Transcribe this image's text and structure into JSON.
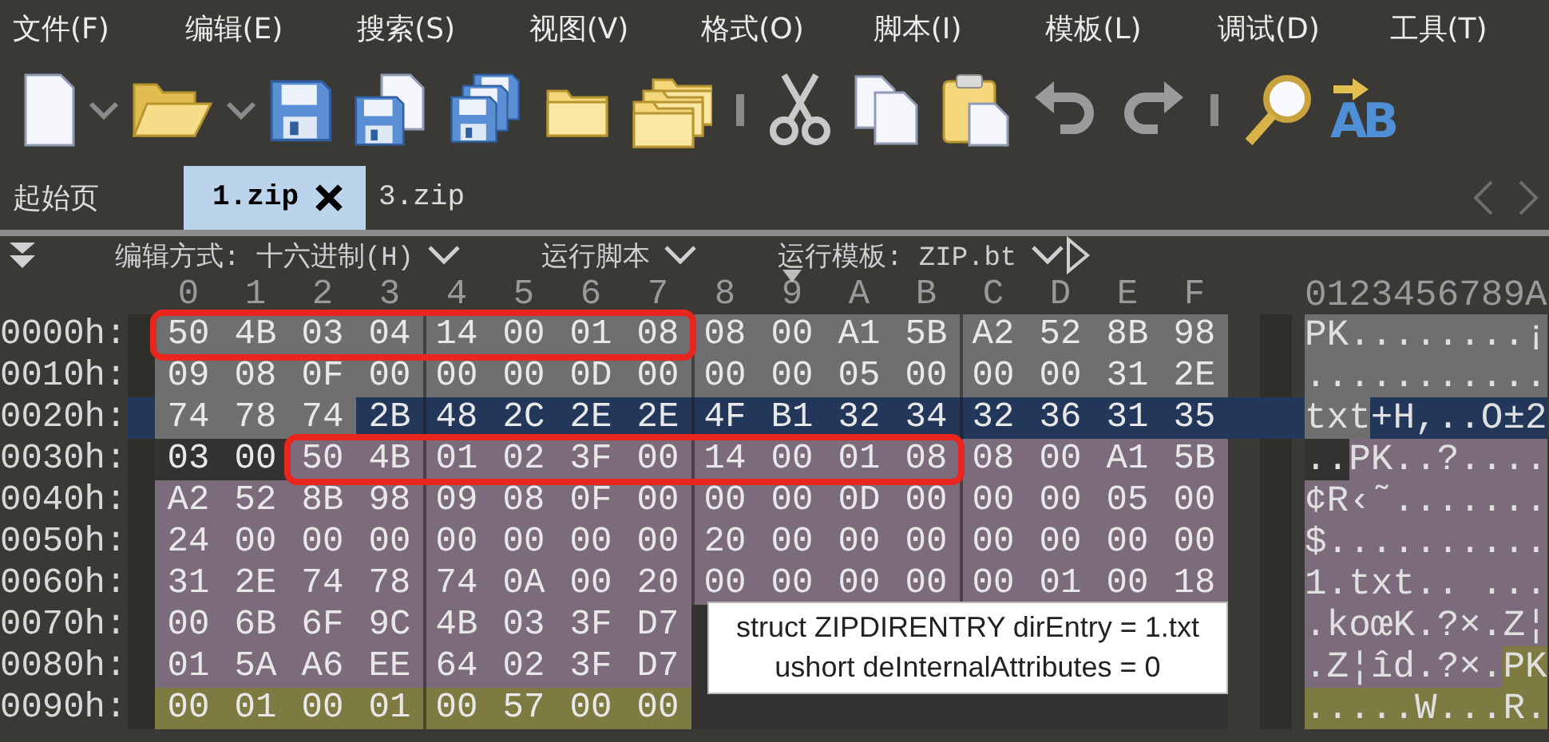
{
  "menu": [
    "文件(F)",
    "编辑(E)",
    "搜索(S)",
    "视图(V)",
    "格式(O)",
    "脚本(I)",
    "模板(L)",
    "调试(D)",
    "工具(T)"
  ],
  "toolbar": [
    {
      "kind": "new"
    },
    {
      "kind": "dropdown"
    },
    {
      "kind": "open"
    },
    {
      "kind": "dropdown"
    },
    {
      "kind": "save"
    },
    {
      "kind": "save-as"
    },
    {
      "kind": "save-all"
    },
    {
      "kind": "folder"
    },
    {
      "kind": "folders"
    },
    {
      "kind": "separator"
    },
    {
      "kind": "cut"
    },
    {
      "kind": "copy"
    },
    {
      "kind": "paste"
    },
    {
      "kind": "undo"
    },
    {
      "kind": "redo"
    },
    {
      "kind": "separator"
    },
    {
      "kind": "find"
    },
    {
      "kind": "replace",
      "label": "AB"
    }
  ],
  "tabs": [
    {
      "label": "起始页",
      "selected": false,
      "closable": false
    },
    {
      "label": "1.zip",
      "selected": true,
      "closable": true
    },
    {
      "label": "3.zip",
      "selected": false,
      "closable": false
    }
  ],
  "options": [
    {
      "label": "编辑方式: 十六进制(H)"
    },
    {
      "label": "运行脚本"
    },
    {
      "label": "运行模板: ZIP.bt"
    }
  ],
  "hex_header": [
    {
      "label": "0",
      "cursor": false
    },
    {
      "label": "1",
      "cursor": false
    },
    {
      "label": "2",
      "cursor": false
    },
    {
      "label": "3",
      "cursor": false
    },
    {
      "label": "4",
      "cursor": false
    },
    {
      "label": "5",
      "cursor": false
    },
    {
      "label": "6",
      "cursor": false
    },
    {
      "label": "7",
      "cursor": false
    },
    {
      "label": "8",
      "cursor": false
    },
    {
      "label": "9",
      "cursor": true
    },
    {
      "label": "A",
      "cursor": false
    },
    {
      "label": "B",
      "cursor": false
    },
    {
      "label": "C",
      "cursor": false
    },
    {
      "label": "D",
      "cursor": false
    },
    {
      "label": "E",
      "cursor": false
    },
    {
      "label": "F",
      "cursor": false
    }
  ],
  "ascii_header": "0123456789A",
  "rows": [
    {
      "offset": "0000h:",
      "current": false,
      "hex": [
        {
          "kind": "header",
          "outlined": true,
          "bytes": "50 4B 03 04 14 00 01 08"
        },
        {
          "kind": "header",
          "outlined": false,
          "bytes": "08 00 A1 5B A2 52 8B 98"
        }
      ],
      "ascii": [
        {
          "kind": "header",
          "text": "PK........¡"
        }
      ]
    },
    {
      "offset": "0010h:",
      "current": false,
      "hex": [
        {
          "kind": "header",
          "outlined": false,
          "bytes": "09 08 0F 00 00 00 0D 00 00 00 05 00 00 00 31 2E"
        }
      ],
      "ascii": [
        {
          "kind": "header",
          "text": "..........."
        }
      ]
    },
    {
      "offset": "0020h:",
      "current": true,
      "hex": [
        {
          "kind": "header",
          "outlined": false,
          "bytes": "74 78 74"
        },
        {
          "kind": "field",
          "outlined": false,
          "bytes": "2B 48 2C 2E 2E 4F B1 32 34 32 36 31 35"
        }
      ],
      "ascii": [
        {
          "kind": "header",
          "text": "txt"
        },
        {
          "kind": "field",
          "text": "+H,..O±2"
        }
      ]
    },
    {
      "offset": "0030h:",
      "current": false,
      "hex": [
        {
          "kind": "none",
          "outlined": false,
          "bytes": "03 00"
        },
        {
          "kind": "direntry",
          "outlined": true,
          "bytes": "50 4B 01 02 3F 00 14 00 01 08"
        },
        {
          "kind": "direntry",
          "outlined": false,
          "bytes": "08 00 A1 5B"
        }
      ],
      "ascii": [
        {
          "kind": "none",
          "text": ".."
        },
        {
          "kind": "direntry",
          "text": "PK..?...."
        }
      ]
    },
    {
      "offset": "0040h:",
      "current": false,
      "hex": [
        {
          "kind": "direntry",
          "outlined": false,
          "bytes": "A2 52 8B 98 09 08 0F 00 00 00 0D 00 00 00 05 00"
        }
      ],
      "ascii": [
        {
          "kind": "direntry",
          "text": "¢R‹˜......."
        }
      ]
    },
    {
      "offset": "0050h:",
      "current": false,
      "hex": [
        {
          "kind": "direntry",
          "outlined": false,
          "bytes": "24 00 00 00 00 00 00 00 20 00 00 00 00 00 00 00"
        }
      ],
      "ascii": [
        {
          "kind": "direntry",
          "text": "$.........."
        }
      ]
    },
    {
      "offset": "0060h:",
      "current": false,
      "hex": [
        {
          "kind": "direntry",
          "outlined": false,
          "bytes": "31 2E 74 78 74 0A 00 20 00 00 00 00 00 01 00 18"
        }
      ],
      "ascii": [
        {
          "kind": "direntry",
          "text": "1.txt.. ..."
        }
      ]
    },
    {
      "offset": "0070h:",
      "current": false,
      "hex": [
        {
          "kind": "direntry",
          "outlined": false,
          "bytes": "00 6B 6F 9C 4B 03 3F D7"
        }
      ],
      "ascii": [
        {
          "kind": "direntry",
          "text": ".koœK.?×.Z¦"
        }
      ]
    },
    {
      "offset": "0080h:",
      "current": false,
      "hex": [
        {
          "kind": "direntry",
          "outlined": false,
          "bytes": "01 5A A6 EE 64 02 3F D7"
        }
      ],
      "ascii": [
        {
          "kind": "direntry",
          "text": ".Z¦îd.?×."
        },
        {
          "kind": "end",
          "text": "PK"
        }
      ]
    },
    {
      "offset": "0090h:",
      "current": false,
      "hex": [
        {
          "kind": "end",
          "outlined": false,
          "bytes": "00 01 00 01 00 57 00 00"
        }
      ],
      "ascii": [
        {
          "kind": "end",
          "text": ".....W...R."
        }
      ]
    }
  ],
  "tooltip": [
    "struct ZIPDIRENTRY dirEntry = 1.txt",
    "ushort deInternalAttributes = 0"
  ]
}
